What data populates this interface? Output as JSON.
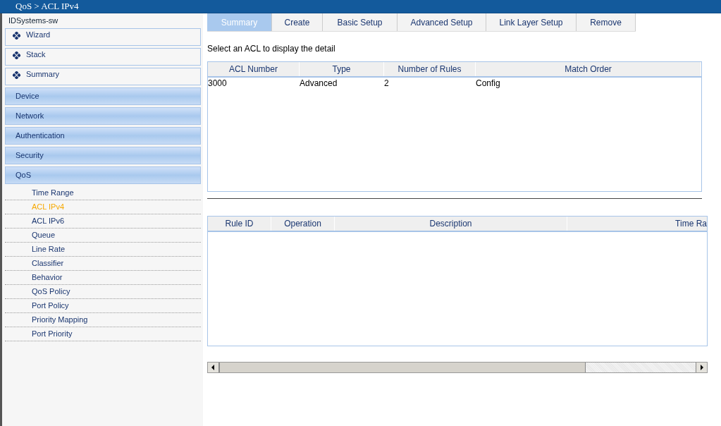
{
  "breadcrumb": "QoS > ACL IPv4",
  "sidebar": {
    "device_name": "IDSystems-sw",
    "items": [
      {
        "kind": "link",
        "label": "Wizard"
      },
      {
        "kind": "link",
        "label": "Stack"
      },
      {
        "kind": "link",
        "label": "Summary"
      },
      {
        "kind": "category",
        "label": "Device"
      },
      {
        "kind": "category",
        "label": "Network"
      },
      {
        "kind": "category",
        "label": "Authentication"
      },
      {
        "kind": "category",
        "label": "Security"
      },
      {
        "kind": "category",
        "label": "QoS",
        "children": [
          {
            "label": "Time Range",
            "selected": false
          },
          {
            "label": "ACL IPv4",
            "selected": true
          },
          {
            "label": "ACL IPv6",
            "selected": false
          },
          {
            "label": "Queue",
            "selected": false
          },
          {
            "label": "Line Rate",
            "selected": false
          },
          {
            "label": "Classifier",
            "selected": false
          },
          {
            "label": "Behavior",
            "selected": false
          },
          {
            "label": "QoS Policy",
            "selected": false
          },
          {
            "label": "Port Policy",
            "selected": false
          },
          {
            "label": "Priority Mapping",
            "selected": false
          },
          {
            "label": "Port Priority",
            "selected": false
          }
        ]
      }
    ]
  },
  "tabs": [
    {
      "label": "Summary",
      "selected": true
    },
    {
      "label": "Create",
      "selected": false
    },
    {
      "label": "Basic Setup",
      "selected": false
    },
    {
      "label": "Advanced Setup",
      "selected": false
    },
    {
      "label": "Link Layer Setup",
      "selected": false
    },
    {
      "label": "Remove",
      "selected": false
    }
  ],
  "instruction": "Select an ACL to display the detail",
  "acl_table": {
    "columns": [
      "ACL Number",
      "Type",
      "Number of Rules",
      "Match Order"
    ],
    "rows": [
      [
        "3000",
        "Advanced",
        "2",
        "Config"
      ]
    ]
  },
  "rule_table": {
    "columns": [
      "Rule ID",
      "Operation",
      "Description",
      "Time Ra"
    ]
  }
}
